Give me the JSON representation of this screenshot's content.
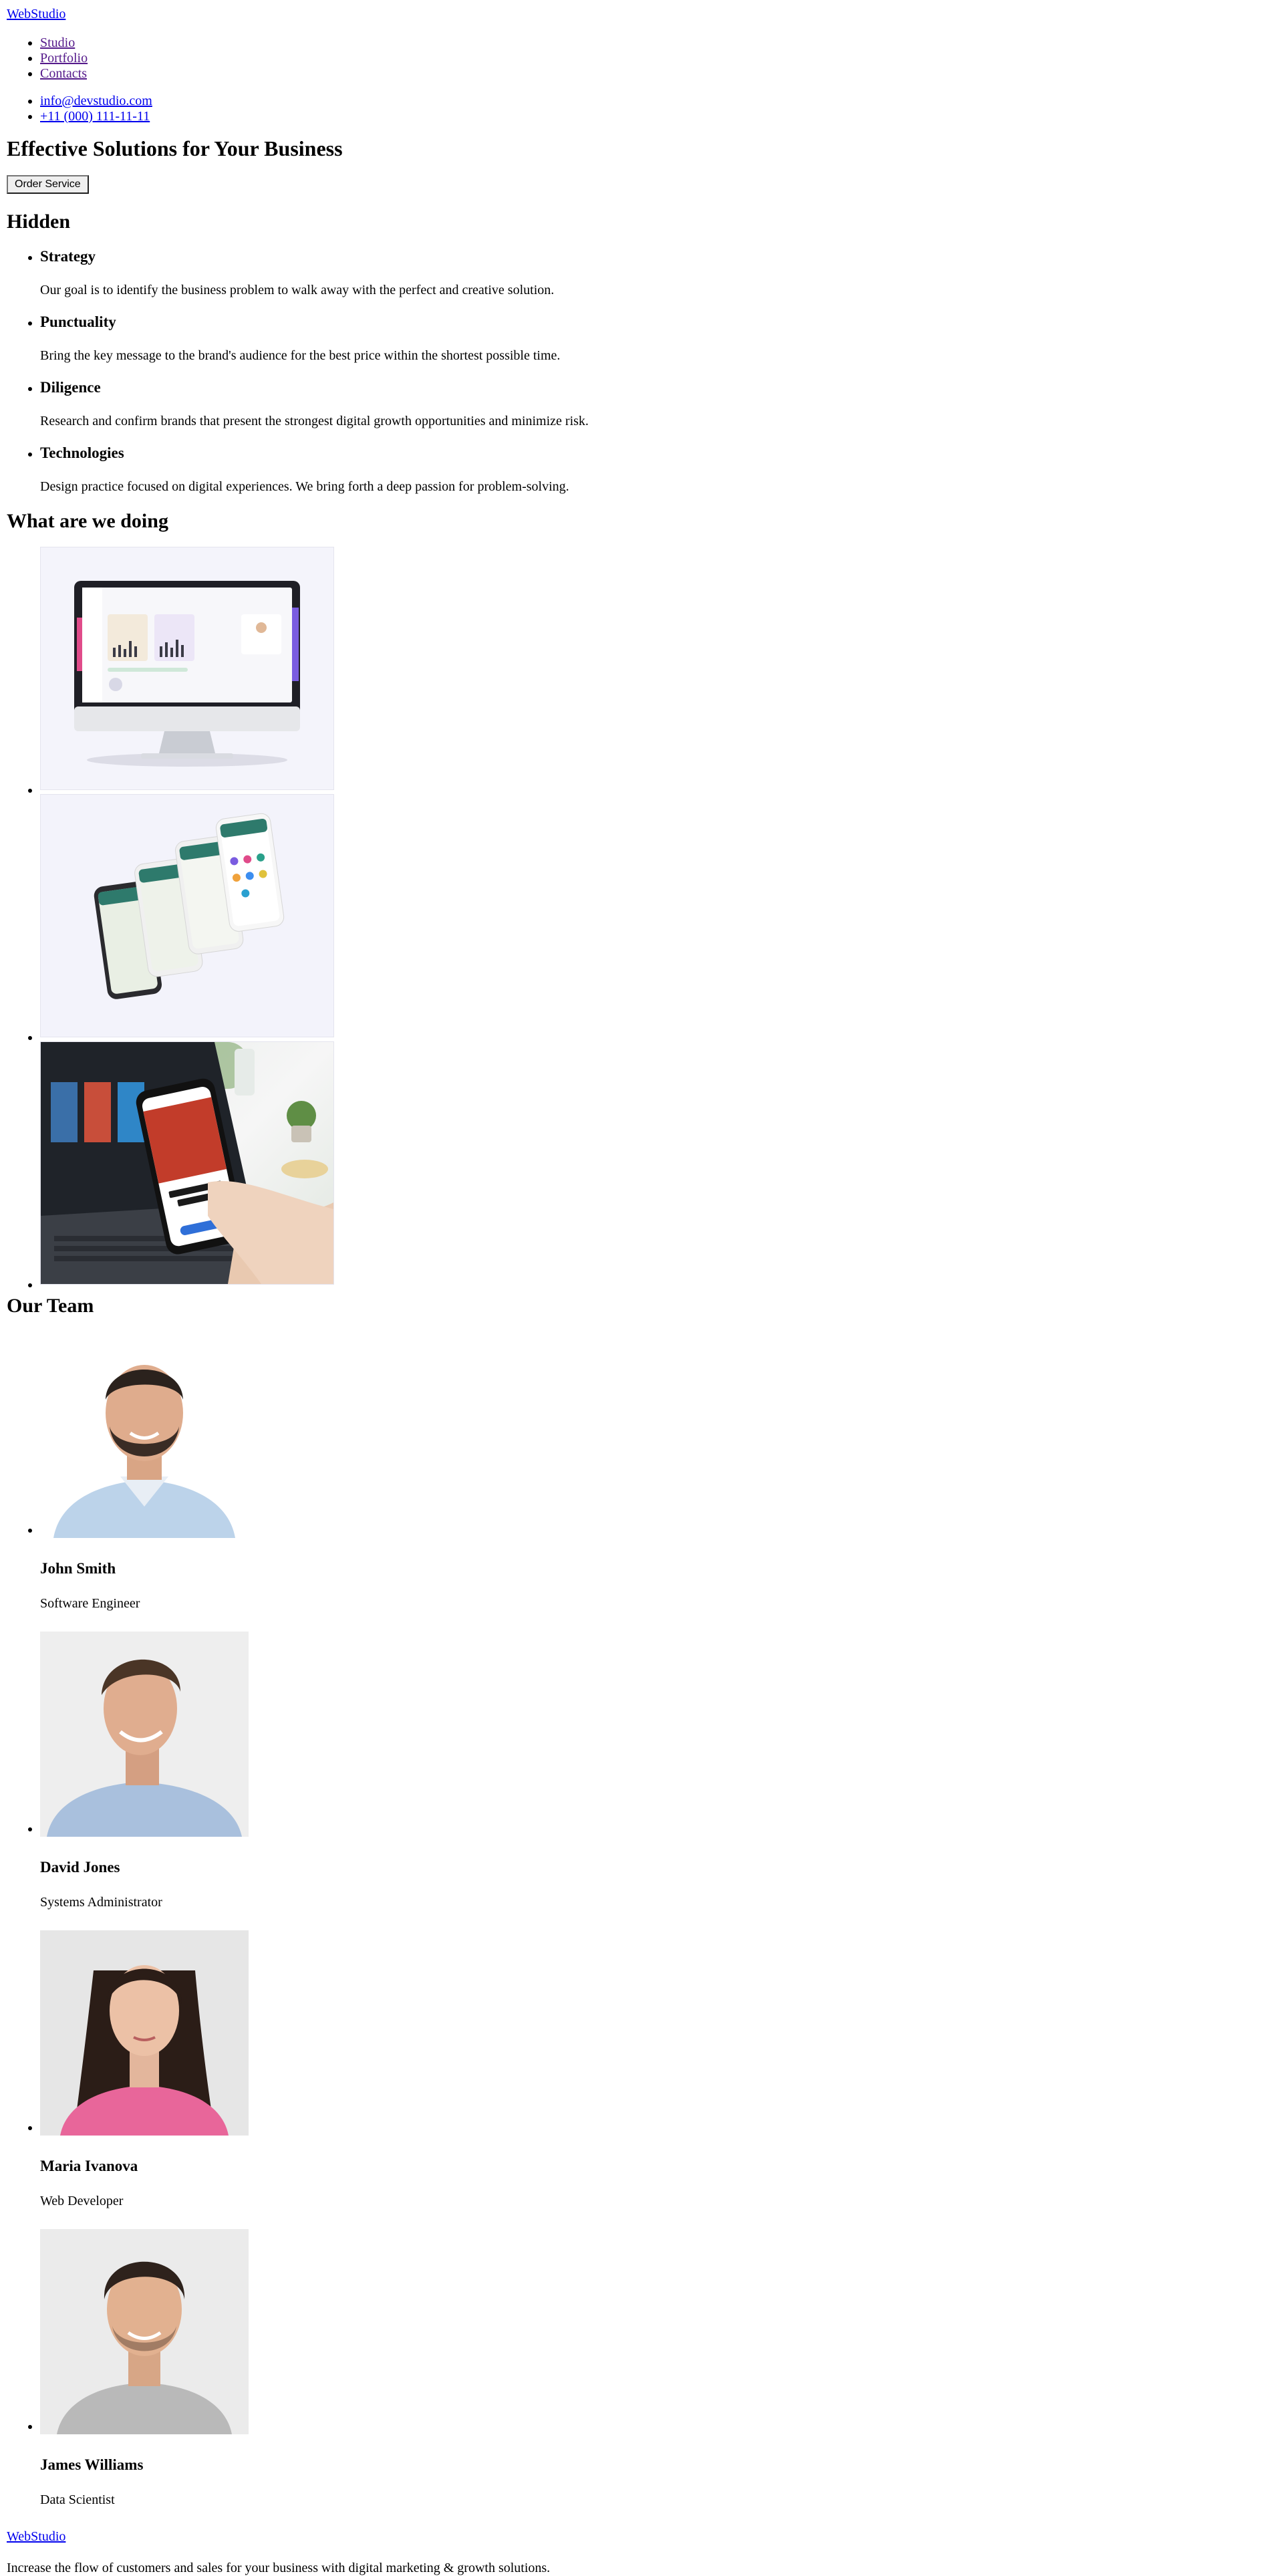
{
  "header": {
    "logo": "WebStudio",
    "nav": [
      {
        "label": "Studio"
      },
      {
        "label": "Portfolio"
      },
      {
        "label": "Contacts"
      }
    ],
    "contacts": [
      {
        "label": "info@devstudio.com"
      },
      {
        "label": "+11 (000) 111-11-11"
      }
    ]
  },
  "hero": {
    "title": "Effective Solutions for Your Business",
    "button": "Order Service"
  },
  "features": {
    "title": "Hidden",
    "items": [
      {
        "title": "Strategy",
        "text": "Our goal is to identify the business problem to walk away with the perfect and creative solution."
      },
      {
        "title": "Punctuality",
        "text": "Bring the key message to the brand's audience for the best price within the shortest possible time."
      },
      {
        "title": "Diligence",
        "text": "Research and confirm brands that present the strongest digital growth opportunities and minimize risk."
      },
      {
        "title": "Technologies",
        "text": "Design practice focused on digital experiences. We bring forth a deep passion for problem-solving."
      }
    ]
  },
  "work": {
    "title": "What are we doing",
    "images": [
      {
        "icon": "desktop-dashboard-mockup-image"
      },
      {
        "icon": "mobile-app-mockup-image"
      },
      {
        "icon": "phone-in-hand-laptop-image"
      }
    ]
  },
  "team": {
    "title": "Our Team",
    "members": [
      {
        "name": "John Smith",
        "role": "Software Engineer"
      },
      {
        "name": "David Jones",
        "role": "Systems Administrator"
      },
      {
        "name": "Maria Ivanova",
        "role": "Web Developer"
      },
      {
        "name": "James Williams",
        "role": "Data Scientist"
      }
    ]
  },
  "footer": {
    "logo": "WebStudio",
    "text": "Increase the flow of customers and sales for your business with digital marketing & growth solutions."
  },
  "colors": {
    "link": "#0000ee",
    "visited": "#551a8b",
    "brand_teal": "#2e7a6c"
  }
}
